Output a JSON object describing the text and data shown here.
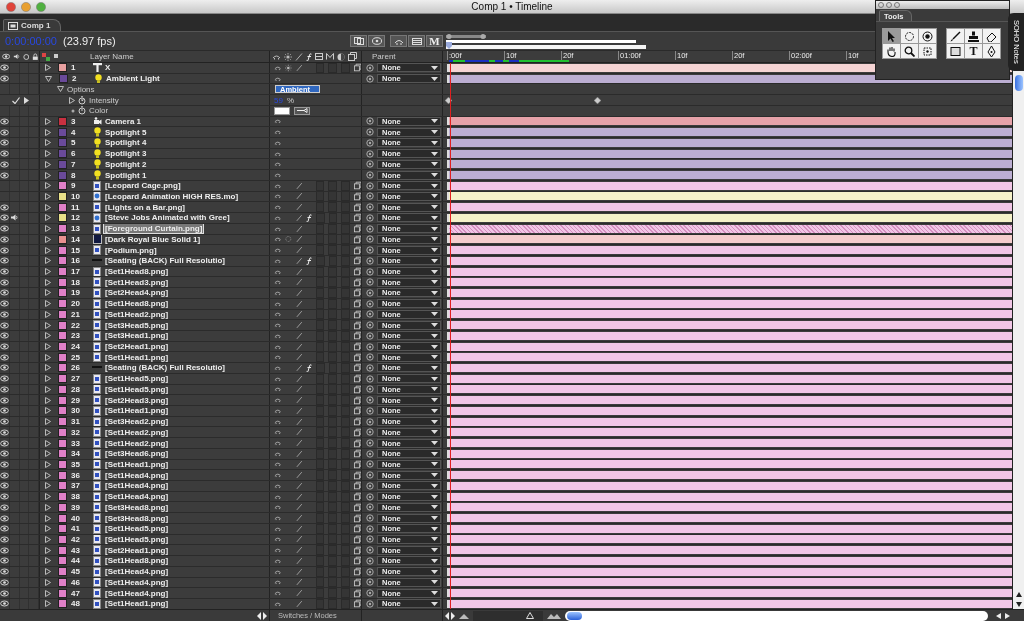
{
  "window": {
    "title": "Comp 1 • Timeline"
  },
  "tabs": [
    {
      "label": "Comp 1",
      "selected": true
    }
  ],
  "timecode": {
    "time": "0:00:00:00",
    "fps": "(23.97 fps)",
    "buttons": [
      {
        "kind": "icon"
      },
      {
        "kind": "icon"
      },
      {
        "kind": "icon"
      },
      {
        "kind": "icon"
      },
      {
        "kind": "text",
        "label": "M"
      }
    ]
  },
  "columns": {
    "layer_name": "Layer Name",
    "parent": "Parent"
  },
  "ruler": [
    ":00f",
    "10f",
    "20f",
    "01:00f",
    "10f",
    "20f",
    "02:00f",
    "10f"
  ],
  "layers": [
    {
      "num": "1",
      "name": "X",
      "kind": "text",
      "color": "#e8a0a0",
      "video": true,
      "audio": false,
      "expanded": false,
      "selected": false,
      "fx": false,
      "parent": "None"
    },
    {
      "num": "2",
      "name": "Ambient Light",
      "kind": "light",
      "color": "#6a4a9a",
      "video": true,
      "audio": false,
      "expanded": true,
      "selected": false,
      "fx": false,
      "parent": "None",
      "children": [
        {
          "kind": "group",
          "name": "Options",
          "value": "Ambient",
          "expanded": true,
          "children": [
            {
              "kind": "value",
              "name": "Intensity",
              "value": "59",
              "unit": "%",
              "expanded": false,
              "keyframed": true
            },
            {
              "kind": "color",
              "name": "Color",
              "color": "#ffffff"
            }
          ]
        }
      ]
    },
    {
      "num": "3",
      "name": "Camera 1",
      "kind": "camera",
      "color": "#c83040",
      "video": true,
      "audio": false,
      "expanded": false,
      "selected": false,
      "fx": false,
      "parent": "None"
    },
    {
      "num": "4",
      "name": "Spotlight 5",
      "kind": "light",
      "color": "#6a4a9a",
      "video": true,
      "audio": false,
      "expanded": false,
      "selected": false,
      "fx": false,
      "parent": "None"
    },
    {
      "num": "5",
      "name": "Spotlight 4",
      "kind": "light",
      "color": "#6a4a9a",
      "video": true,
      "audio": false,
      "expanded": false,
      "selected": false,
      "fx": false,
      "parent": "None"
    },
    {
      "num": "6",
      "name": "Spotlight 3",
      "kind": "light",
      "color": "#6a4a9a",
      "video": true,
      "audio": false,
      "expanded": false,
      "selected": false,
      "fx": false,
      "parent": "None"
    },
    {
      "num": "7",
      "name": "Spotlight 2",
      "kind": "light",
      "color": "#6a4a9a",
      "video": true,
      "audio": false,
      "expanded": false,
      "selected": false,
      "fx": false,
      "parent": "None"
    },
    {
      "num": "8",
      "name": "Spotlight 1",
      "kind": "light",
      "color": "#6a4a9a",
      "video": true,
      "audio": false,
      "expanded": false,
      "selected": false,
      "fx": false,
      "parent": "None"
    },
    {
      "num": "9",
      "name": "[Leopard Cage.png]",
      "kind": "still",
      "color": "#e080c8",
      "video": false,
      "audio": false,
      "expanded": false,
      "selected": false,
      "fx": false,
      "parent": "None"
    },
    {
      "num": "10",
      "name": "[Leopard Animation HIGH RES.mo]",
      "kind": "movie",
      "color": "#e8e088",
      "video": false,
      "audio": false,
      "expanded": false,
      "selected": false,
      "fx": false,
      "parent": "None"
    },
    {
      "num": "11",
      "name": "[Lights on a Bar.png]",
      "kind": "still",
      "color": "#e080c8",
      "video": true,
      "audio": false,
      "expanded": false,
      "selected": false,
      "fx": false,
      "parent": "None"
    },
    {
      "num": "12",
      "name": "[Steve Jobs Animated with Gree]",
      "kind": "movie",
      "color": "#e8e088",
      "video": true,
      "audio": true,
      "expanded": false,
      "selected": false,
      "fx": true,
      "parent": "None"
    },
    {
      "num": "13",
      "name": "[Foreground Curtain.png]",
      "kind": "still",
      "color": "#e080c8",
      "video": true,
      "audio": false,
      "expanded": false,
      "selected": true,
      "fx": false,
      "parent": "None"
    },
    {
      "num": "14",
      "name": "[Dark Royal Blue Solid 1]",
      "kind": "solid",
      "color": "#e89090",
      "video": true,
      "audio": false,
      "expanded": false,
      "selected": false,
      "fx": false,
      "parent": "None"
    },
    {
      "num": "15",
      "name": "[Podium.png]",
      "kind": "still",
      "color": "#e080c8",
      "video": true,
      "audio": false,
      "expanded": false,
      "selected": false,
      "fx": false,
      "parent": "None"
    },
    {
      "num": "16",
      "name": "[Seating (BACK) Full Resolutio]",
      "kind": "sequence",
      "color": "#e080c8",
      "video": true,
      "audio": false,
      "expanded": false,
      "selected": false,
      "fx": true,
      "parent": "None"
    },
    {
      "num": "17",
      "name": "[Set1Head8.png]",
      "kind": "still",
      "color": "#e080c8",
      "video": true,
      "audio": false,
      "expanded": false,
      "selected": false,
      "fx": false,
      "parent": "None"
    },
    {
      "num": "18",
      "name": "[Set1Head3.png]",
      "kind": "still",
      "color": "#e080c8",
      "video": true,
      "audio": false,
      "expanded": false,
      "selected": false,
      "fx": false,
      "parent": "None"
    },
    {
      "num": "19",
      "name": "[Set2Head4.png]",
      "kind": "still",
      "color": "#e080c8",
      "video": true,
      "audio": false,
      "expanded": false,
      "selected": false,
      "fx": false,
      "parent": "None"
    },
    {
      "num": "20",
      "name": "[Set1Head8.png]",
      "kind": "still",
      "color": "#e080c8",
      "video": true,
      "audio": false,
      "expanded": false,
      "selected": false,
      "fx": false,
      "parent": "None"
    },
    {
      "num": "21",
      "name": "[Set1Head2.png]",
      "kind": "still",
      "color": "#e080c8",
      "video": true,
      "audio": false,
      "expanded": false,
      "selected": false,
      "fx": false,
      "parent": "None"
    },
    {
      "num": "22",
      "name": "[Set3Head5.png]",
      "kind": "still",
      "color": "#e080c8",
      "video": true,
      "audio": false,
      "expanded": false,
      "selected": false,
      "fx": false,
      "parent": "None"
    },
    {
      "num": "23",
      "name": "[Set3Head1.png]",
      "kind": "still",
      "color": "#e080c8",
      "video": true,
      "audio": false,
      "expanded": false,
      "selected": false,
      "fx": false,
      "parent": "None"
    },
    {
      "num": "24",
      "name": "[Set2Head1.png]",
      "kind": "still",
      "color": "#e080c8",
      "video": true,
      "audio": false,
      "expanded": false,
      "selected": false,
      "fx": false,
      "parent": "None"
    },
    {
      "num": "25",
      "name": "[Set1Head1.png]",
      "kind": "still",
      "color": "#e080c8",
      "video": true,
      "audio": false,
      "expanded": false,
      "selected": false,
      "fx": false,
      "parent": "None"
    },
    {
      "num": "26",
      "name": "[Seating (BACK) Full Resolutio]",
      "kind": "sequence",
      "color": "#e080c8",
      "video": true,
      "audio": false,
      "expanded": false,
      "selected": false,
      "fx": true,
      "parent": "None"
    },
    {
      "num": "27",
      "name": "[Set1Head5.png]",
      "kind": "still",
      "color": "#e080c8",
      "video": true,
      "audio": false,
      "expanded": false,
      "selected": false,
      "fx": false,
      "parent": "None"
    },
    {
      "num": "28",
      "name": "[Set1Head5.png]",
      "kind": "still",
      "color": "#e080c8",
      "video": true,
      "audio": false,
      "expanded": false,
      "selected": false,
      "fx": false,
      "parent": "None"
    },
    {
      "num": "29",
      "name": "[Set2Head3.png]",
      "kind": "still",
      "color": "#e080c8",
      "video": true,
      "audio": false,
      "expanded": false,
      "selected": false,
      "fx": false,
      "parent": "None"
    },
    {
      "num": "30",
      "name": "[Set1Head1.png]",
      "kind": "still",
      "color": "#e080c8",
      "video": true,
      "audio": false,
      "expanded": false,
      "selected": false,
      "fx": false,
      "parent": "None"
    },
    {
      "num": "31",
      "name": "[Set3Head2.png]",
      "kind": "still",
      "color": "#e080c8",
      "video": true,
      "audio": false,
      "expanded": false,
      "selected": false,
      "fx": false,
      "parent": "None"
    },
    {
      "num": "32",
      "name": "[Set1Head2.png]",
      "kind": "still",
      "color": "#e080c8",
      "video": true,
      "audio": false,
      "expanded": false,
      "selected": false,
      "fx": false,
      "parent": "None"
    },
    {
      "num": "33",
      "name": "[Set1Head2.png]",
      "kind": "still",
      "color": "#e080c8",
      "video": true,
      "audio": false,
      "expanded": false,
      "selected": false,
      "fx": false,
      "parent": "None"
    },
    {
      "num": "34",
      "name": "[Set3Head6.png]",
      "kind": "still",
      "color": "#e080c8",
      "video": true,
      "audio": false,
      "expanded": false,
      "selected": false,
      "fx": false,
      "parent": "None"
    },
    {
      "num": "35",
      "name": "[Set1Head1.png]",
      "kind": "still",
      "color": "#e080c8",
      "video": true,
      "audio": false,
      "expanded": false,
      "selected": false,
      "fx": false,
      "parent": "None"
    },
    {
      "num": "36",
      "name": "[Set1Head4.png]",
      "kind": "still",
      "color": "#e080c8",
      "video": true,
      "audio": false,
      "expanded": false,
      "selected": false,
      "fx": false,
      "parent": "None"
    },
    {
      "num": "37",
      "name": "[Set1Head4.png]",
      "kind": "still",
      "color": "#e080c8",
      "video": true,
      "audio": false,
      "expanded": false,
      "selected": false,
      "fx": false,
      "parent": "None"
    },
    {
      "num": "38",
      "name": "[Set1Head4.png]",
      "kind": "still",
      "color": "#e080c8",
      "video": true,
      "audio": false,
      "expanded": false,
      "selected": false,
      "fx": false,
      "parent": "None"
    },
    {
      "num": "39",
      "name": "[Set3Head8.png]",
      "kind": "still",
      "color": "#e080c8",
      "video": true,
      "audio": false,
      "expanded": false,
      "selected": false,
      "fx": false,
      "parent": "None"
    },
    {
      "num": "40",
      "name": "[Set3Head8.png]",
      "kind": "still",
      "color": "#e080c8",
      "video": true,
      "audio": false,
      "expanded": false,
      "selected": false,
      "fx": false,
      "parent": "None"
    },
    {
      "num": "41",
      "name": "[Set1Head5.png]",
      "kind": "still",
      "color": "#e080c8",
      "video": true,
      "audio": false,
      "expanded": false,
      "selected": false,
      "fx": false,
      "parent": "None"
    },
    {
      "num": "42",
      "name": "[Set1Head5.png]",
      "kind": "still",
      "color": "#e080c8",
      "video": true,
      "audio": false,
      "expanded": false,
      "selected": false,
      "fx": false,
      "parent": "None"
    },
    {
      "num": "43",
      "name": "[Set2Head1.png]",
      "kind": "still",
      "color": "#e080c8",
      "video": true,
      "audio": false,
      "expanded": false,
      "selected": false,
      "fx": false,
      "parent": "None"
    },
    {
      "num": "44",
      "name": "[Set1Head8.png]",
      "kind": "still",
      "color": "#e080c8",
      "video": true,
      "audio": false,
      "expanded": false,
      "selected": false,
      "fx": false,
      "parent": "None"
    },
    {
      "num": "45",
      "name": "[Set1Head4.png]",
      "kind": "still",
      "color": "#e080c8",
      "video": true,
      "audio": false,
      "expanded": false,
      "selected": false,
      "fx": false,
      "parent": "None"
    },
    {
      "num": "46",
      "name": "[Set1Head4.png]",
      "kind": "still",
      "color": "#e080c8",
      "video": true,
      "audio": false,
      "expanded": false,
      "selected": false,
      "fx": false,
      "parent": "None"
    },
    {
      "num": "47",
      "name": "[Set1Head4.png]",
      "kind": "still",
      "color": "#e080c8",
      "video": true,
      "audio": false,
      "expanded": false,
      "selected": false,
      "fx": false,
      "parent": "None"
    },
    {
      "num": "48",
      "name": "[Set1Head1.png]",
      "kind": "still",
      "color": "#e080c8",
      "video": true,
      "audio": false,
      "expanded": false,
      "selected": false,
      "fx": false,
      "parent": "None"
    }
  ],
  "bottom_bar": {
    "toggle": "Switches / Modes",
    "zoom": {
      "level": 0.9
    }
  },
  "tools_panel": {
    "title": "Tools",
    "tools": [
      {
        "kind": "selection",
        "selected": true
      },
      {
        "kind": "rotate",
        "selected": false
      },
      {
        "kind": "orbit",
        "selected": false
      },
      {
        "kind": "hand",
        "selected": false
      },
      {
        "kind": "zoom",
        "selected": false
      },
      {
        "kind": "pan",
        "selected": false
      },
      {
        "kind": "brush",
        "selected": false
      },
      {
        "kind": "stamp",
        "selected": false
      },
      {
        "kind": "eraser",
        "selected": false
      },
      {
        "kind": "rectangle",
        "selected": false
      },
      {
        "kind": "type",
        "label": "T",
        "selected": false
      },
      {
        "kind": "pen",
        "selected": false
      }
    ]
  },
  "side_tab": {
    "label": "SOHO Notes"
  }
}
